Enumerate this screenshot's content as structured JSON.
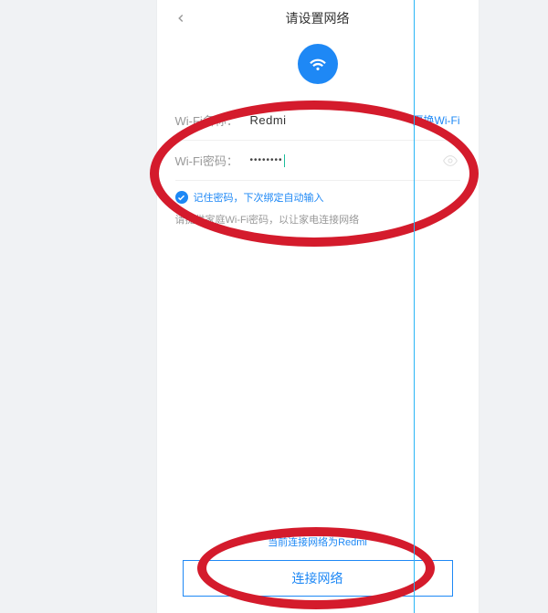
{
  "header": {
    "title": "请设置网络"
  },
  "wifi": {
    "name_label": "Wi-Fi名称：",
    "name_value": "Redmi",
    "change_label": "更换Wi-Fi",
    "password_label": "Wi-Fi密码：",
    "password_masked": "••••••••"
  },
  "remember": {
    "label": "记住密码，下次绑定自动输入"
  },
  "hint": {
    "text": "请提供家庭Wi-Fi密码，以让家电连接网络"
  },
  "bottom": {
    "current_text": "当前连接网络为Redmi",
    "connect_label": "连接网络"
  }
}
